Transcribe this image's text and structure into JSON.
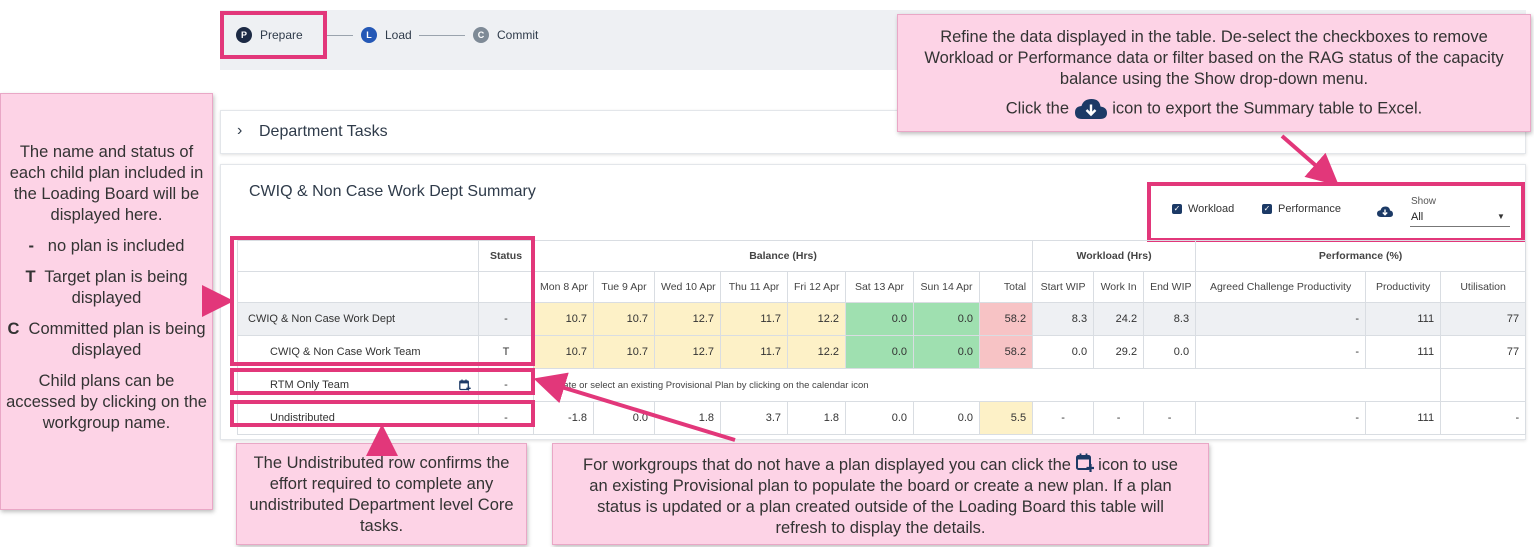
{
  "stepper": {
    "steps": [
      {
        "letter": "P",
        "label": "Prepare",
        "color": "#1c2a44"
      },
      {
        "letter": "L",
        "label": "Load",
        "color": "#2458b6"
      },
      {
        "letter": "C",
        "label": "Commit",
        "color": "#7e8a96"
      }
    ]
  },
  "dept_tasks": {
    "label": "Department Tasks"
  },
  "summary": {
    "title": "CWIQ & Non Case Work Dept Summary",
    "filters": {
      "workload": "Workload",
      "performance": "Performance",
      "show_label": "Show",
      "show_value": "All"
    },
    "group_headers": {
      "status": "Status",
      "balance": "Balance (Hrs)",
      "workload": "Workload (Hrs)",
      "performance": "Performance (%)"
    },
    "columns": [
      "Mon 8 Apr",
      "Tue 9 Apr",
      "Wed 10 Apr",
      "Thu 11 Apr",
      "Fri 12 Apr",
      "Sat 13 Apr",
      "Sun 14 Apr",
      "Total",
      "Start WIP",
      "Work In",
      "End WIP",
      "Agreed Challenge Productivity",
      "Productivity",
      "Utilisation"
    ],
    "rows": {
      "dept": {
        "name": "CWIQ & Non Case Work Dept",
        "status": "-",
        "values": [
          "10.7",
          "10.7",
          "12.7",
          "11.7",
          "12.2",
          "0.0",
          "0.0",
          "58.2",
          "8.3",
          "24.2",
          "8.3",
          "-",
          "111",
          "77"
        ]
      },
      "team": {
        "name": "CWIQ & Non Case Work Team",
        "status": "T",
        "values": [
          "10.7",
          "10.7",
          "12.7",
          "11.7",
          "12.2",
          "0.0",
          "0.0",
          "58.2",
          "0.0",
          "29.2",
          "0.0",
          "-",
          "111",
          "77"
        ]
      },
      "rtm": {
        "name": "RTM Only Team",
        "status": "-",
        "message": "Create or select an existing Provisional Plan by clicking on the calendar icon"
      },
      "undistributed": {
        "name": "Undistributed",
        "status": "-",
        "values": [
          "-1.8",
          "0.0",
          "1.8",
          "3.7",
          "1.8",
          "0.0",
          "0.0",
          "5.5",
          "-",
          "-",
          "-",
          "-",
          "111",
          "-"
        ]
      }
    }
  },
  "callouts": {
    "left": {
      "intro": "The name and status of each child plan included in the Loading Board will be displayed here.",
      "dash_key": "-",
      "dash_text": "no plan is included",
      "t_key": "T",
      "t_text": "Target plan is being displayed",
      "c_key": "C",
      "c_text": "Committed plan is being displayed",
      "outro": "Child plans can be accessed by clicking on the workgroup name."
    },
    "top_right": {
      "line1": "Refine the data displayed in the table. De-select the checkboxes to remove Workload or Performance data or filter based on the RAG status of the capacity balance using the Show drop-down menu.",
      "line2_pre": "Click the",
      "line2_post": "icon to export the Summary table to Excel."
    },
    "bottom_left": "The Undistributed row confirms the effort required to complete any undistributed Department level Core tasks.",
    "bottom_right_pre": "For workgroups that do not have a plan displayed you can click the",
    "bottom_right_post": "icon to use an existing Provisional plan to populate the board or create a new plan. If a plan status is updated or a plan created outside of the Loading Board this table will refresh to display the details."
  },
  "colors": {
    "accent": "#e2377a",
    "callout_bg": "#fdd3e6",
    "amber": "#fdf1c7",
    "green": "#9fe0b0",
    "red": "#f7c3c5",
    "navy": "#1c3a66"
  }
}
